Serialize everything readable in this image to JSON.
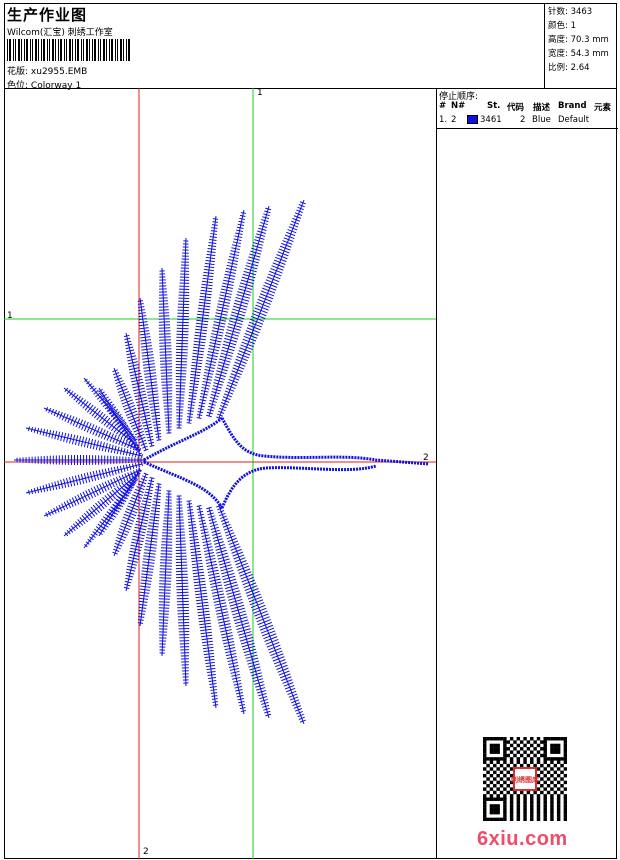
{
  "header": {
    "title": "生产作业图",
    "studio": "Wilcom(汇宝) 刺绣工作室",
    "design_label": "花版:",
    "design_value": "xu2955.EMB",
    "colorway_label": "色位:",
    "colorway_value": "Colorway 1"
  },
  "stats": [
    {
      "label": "针数:",
      "value": "3463"
    },
    {
      "label": "颜色:",
      "value": "1"
    },
    {
      "label": "高度:",
      "value": "70.3 mm"
    },
    {
      "label": "宽度:",
      "value": "54.3 mm"
    },
    {
      "label": "比例:",
      "value": "2.64"
    }
  ],
  "stop_sequence": {
    "title": "停止顺序:",
    "columns": [
      "#",
      "N#",
      "St.",
      "代码",
      "描述",
      "Brand",
      "元素"
    ],
    "rows": [
      {
        "index": "1.",
        "needle": "2",
        "stitches": "3461",
        "code": "2",
        "description": "Blue",
        "brand": "Default",
        "element": ""
      }
    ]
  },
  "guides": {
    "vertical_top": "1",
    "horizontal_left": "1",
    "horizontal_right": "2",
    "vertical_bottom": "2"
  },
  "colors": {
    "thread": "#1010e0",
    "guide_green": "#22cc22",
    "guide_red": "#dd2222",
    "watermark": "#ef4c6a"
  },
  "watermark": "6xiu.com",
  "stamp_text": "刺绣图库"
}
